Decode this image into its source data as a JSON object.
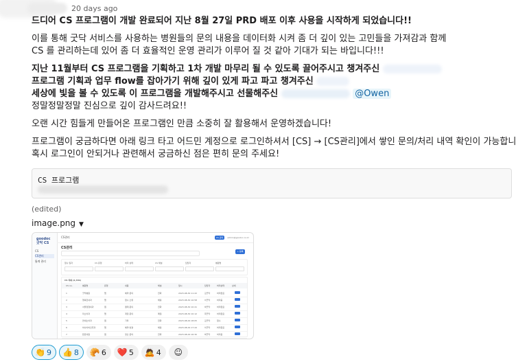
{
  "message": {
    "timestamp": "20 days ago",
    "headline": "드디어 CS 프로그램이 개발 완료되어 지난 8월 27일 PRD 배포 이후 사용을 시작하게 되었습니다!!",
    "para1_line1": "이를 통해 굿닥 서비스를 사용하는 병원들의 문의 내용을 데이터화 시켜 좀 더 깊이 있는 고민들을 가져감과 함께",
    "para1_line2": "CS 를 관리하는데 있어 좀 더 효율적인 운영 관리가 이루어 질 것 같아 기대가 되는 바입니다!!!",
    "thanks_line1": "지난 11월부터 CS 프로그램을 기획하고 1차 개발 마무리 될 수 있도록 끌어주시고 챙겨주신",
    "thanks_line2": "프로그램 기획과 업무 flow를 잡아가기 위해 깊이 있게 파고 파고 챙겨주신",
    "thanks_line3": "세상에 빛을 볼 수 있도록 이 프로그램을 개발해주시고 선물해주신",
    "mention_owen": "@Owen",
    "thanks_line4": "정말정말정말 진심으로 깊이 감사드려요!!",
    "para3": "오랜 시간 힘들게 만들어온 프로그램인 만큼 소중히 잘 활용해서 운영하겠습니다!",
    "para4_line1": "프로그램이 궁금하다면 아래 링크 타고 어드민 계정으로 로그인하셔서 [CS] → [CS관리]에서 쌓인 문의/처리 내역 확인이 가능합니다!",
    "para4_line2": "혹시 로그인이 안되거나 관련해서 궁금하신 점은 편히 문의 주세요!",
    "code_label": "CS 프로그램",
    "edited": "(edited)",
    "attachment_name": "image.png"
  },
  "thumbnail": {
    "logo_line1": "goodoc",
    "logo_line2": "굿닥 CS",
    "nav": [
      "CS",
      "CS관리",
      "통계 관리"
    ],
    "top_title": "CS관리",
    "top_button": "CS 관리",
    "top_user": "admin@goodoc.co.kr",
    "page_title": "CS관리",
    "add_button": "+ 등록",
    "filter_labels": [
      "접수 일자",
      "CS 유형",
      "처리 상태",
      "CS 채널",
      "담당자",
      "병원명"
    ],
    "table_title": "CS 목록 (2,341)",
    "columns": [
      "CS no.",
      "병원명",
      "유형",
      "내용",
      "채널",
      "일시",
      "담당자",
      "처리상태",
      "상세"
    ],
    "rows": [
      [
        "1",
        "굿닥병원",
        "앱",
        "예약 문의",
        "전화",
        "2023-08-30 11:22",
        "김굿닥",
        "처리완료"
      ],
      [
        "2",
        "행복한내과",
        "앱",
        "접수 오류",
        "채팅",
        "2023-08-30 10:58",
        "이굿닥",
        "처리중"
      ],
      [
        "3",
        "서울정형외과",
        "웹",
        "결제 문의",
        "전화",
        "2023-08-30 10:41",
        "박굿닥",
        "처리완료"
      ],
      [
        "4",
        "미소치과",
        "앱",
        "계정 문의",
        "메일",
        "2023-08-30 10:12",
        "최굿닥",
        "처리완료"
      ],
      [
        "5",
        "연세소아과",
        "웹",
        "기타",
        "전화",
        "2023-08-29 18:05",
        "김굿닥",
        "접수"
      ],
      [
        "6",
        "하나이비인후과",
        "앱",
        "예약 변경",
        "채팅",
        "2023-08-29 17:44",
        "이굿닥",
        "처리완료"
      ],
      [
        "7",
        "튼튼의원",
        "웹",
        "정산 문의",
        "전화",
        "2023-08-29 16:30",
        "박굿닥",
        "처리중"
      ]
    ]
  },
  "reactions": [
    {
      "emoji": "👏",
      "count": "9",
      "icon": "clap-icon",
      "selected": true
    },
    {
      "emoji": "👍",
      "count": "8",
      "icon": "thumbs-up-icon",
      "selected": true
    },
    {
      "emoji": "🥐",
      "count": "6",
      "icon": "croissant-icon",
      "selected": false
    },
    {
      "emoji": "❤️",
      "count": "5",
      "icon": "heart-icon",
      "selected": false
    },
    {
      "emoji": "🙇",
      "count": "4",
      "icon": "bow-icon",
      "selected": false
    }
  ],
  "add_reaction_icon": "☺",
  "colors": {
    "mention_bg": "#e8f5fa",
    "mention_fg": "#1264a3",
    "selected_border": "#1d9bd1"
  }
}
